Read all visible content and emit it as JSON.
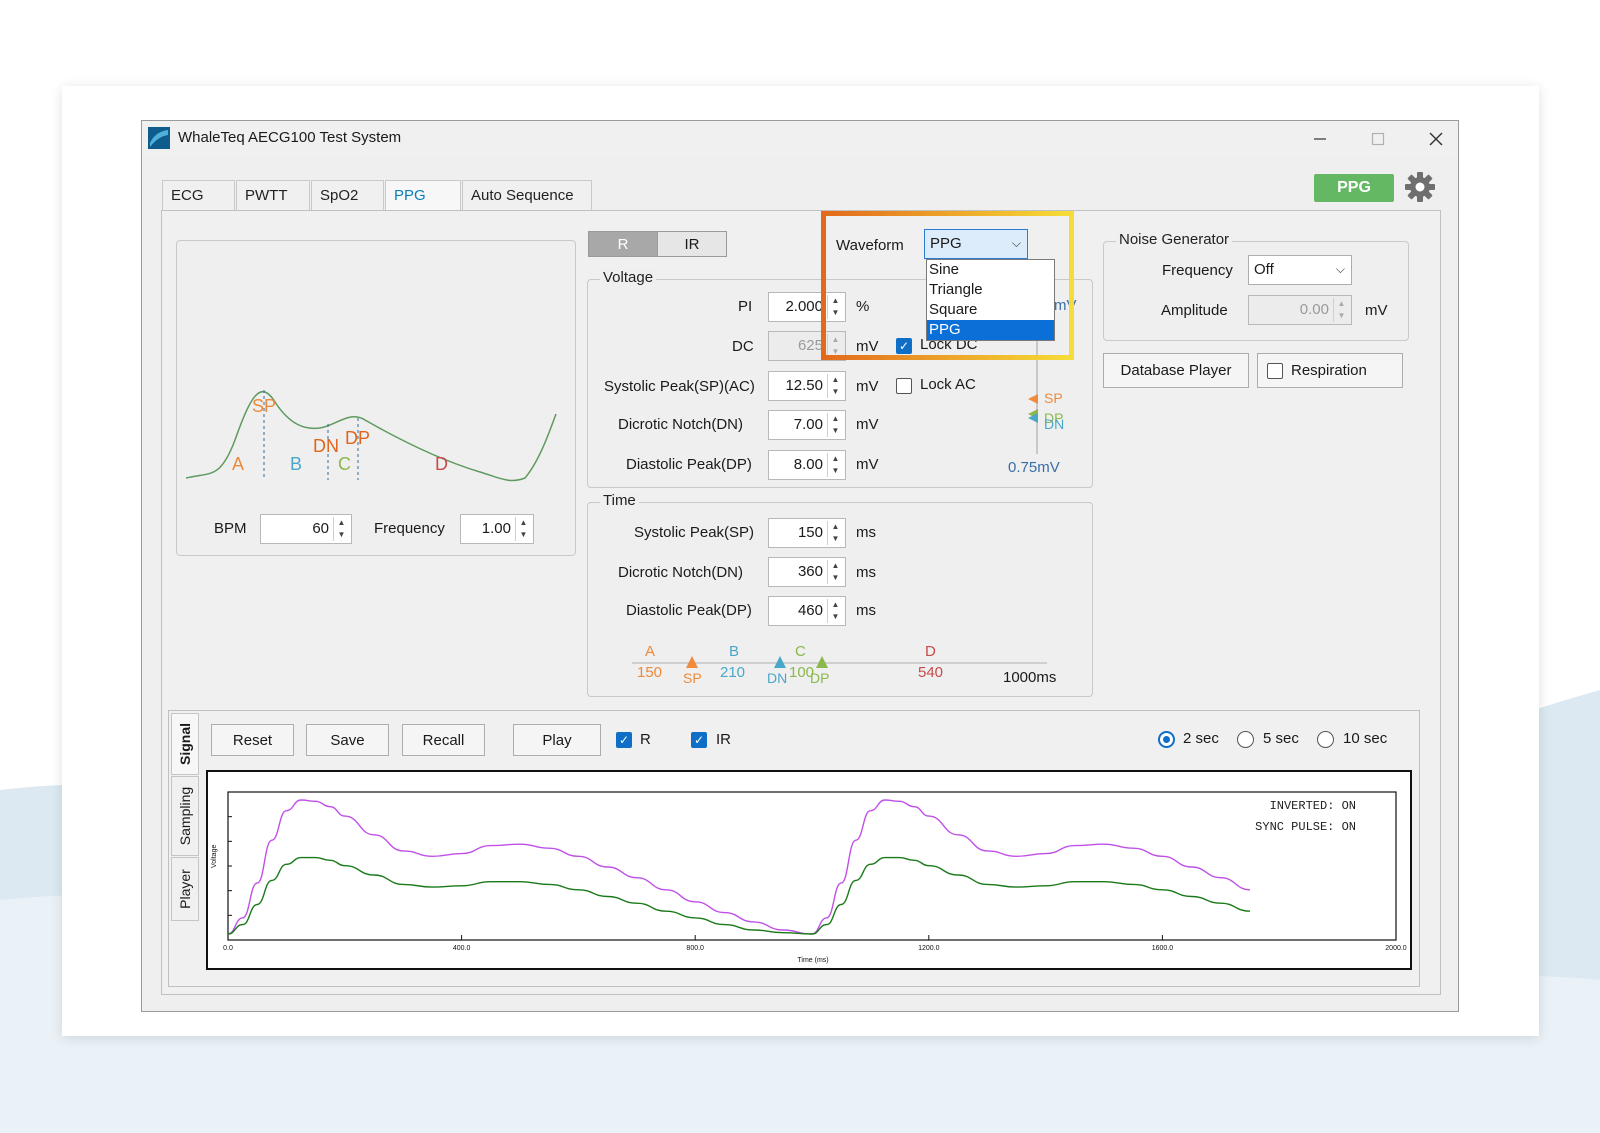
{
  "window": {
    "title": "WhaleTeq AECG100 Test System"
  },
  "tabs": [
    {
      "label": "ECG"
    },
    {
      "label": "PWTT"
    },
    {
      "label": "SpO2"
    },
    {
      "label": "PPG"
    },
    {
      "label": "Auto Sequence"
    }
  ],
  "mode_badge": "PPG",
  "preview": {
    "markers": [
      "SP",
      "DN",
      "DP"
    ],
    "segments": [
      "A",
      "B",
      "C",
      "D"
    ],
    "bpm_label": "BPM",
    "bpm_value": "60",
    "frequency_label": "Frequency",
    "frequency_value": "1.00"
  },
  "channel_toggle": {
    "r": "R",
    "ir": "IR"
  },
  "voltage": {
    "title": "Voltage",
    "pi_label": "PI",
    "pi_value": "2.000",
    "pi_unit": "%",
    "dc_label": "DC",
    "dc_value": "625",
    "dc_unit": "mV",
    "lock_dc_label": "Lock DC",
    "sp_label": "Systolic Peak(SP)(AC)",
    "sp_value": "12.50",
    "sp_unit": "mV",
    "lock_ac_label": "Lock AC",
    "dn_label": "Dicrotic Notch(DN)",
    "dn_value": "7.00",
    "dn_unit": "mV",
    "dp_label": "Diastolic Peak(DP)",
    "dp_value": "8.00",
    "dp_unit": "mV",
    "scale_top": "mV",
    "scale_value": "0.75mV",
    "scale_sp": "SP",
    "scale_dp": "DP",
    "scale_dn": "DN"
  },
  "waveform": {
    "label": "Waveform",
    "selected": "PPG",
    "options": [
      "Sine",
      "Triangle",
      "Square",
      "PPG"
    ]
  },
  "time": {
    "title": "Time",
    "sp_label": "Systolic Peak(SP)",
    "sp_value": "150",
    "sp_unit": "ms",
    "dn_label": "Dicrotic Notch(DN)",
    "dn_value": "360",
    "dn_unit": "ms",
    "dp_label": "Diastolic Peak(DP)",
    "dp_value": "460",
    "dp_unit": "ms",
    "timeline": {
      "a": "A",
      "a_val": "150",
      "b": "B",
      "b_val": "210",
      "c": "C",
      "c_val": "100",
      "d": "D",
      "d_val": "540",
      "sp": "SP",
      "dn": "DN",
      "dp": "DP",
      "end": "1000ms"
    }
  },
  "noise": {
    "title": "Noise Generator",
    "frequency_label": "Frequency",
    "frequency_value": "Off",
    "amplitude_label": "Amplitude",
    "amplitude_value": "0.00",
    "amplitude_unit": "mV"
  },
  "database_player_label": "Database Player",
  "respiration_label": "Respiration",
  "bottom": {
    "vtabs": [
      "Signal",
      "Sampling",
      "Player"
    ],
    "buttons": {
      "reset": "Reset",
      "save": "Save",
      "recall": "Recall",
      "play": "Play"
    },
    "r_label": "R",
    "ir_label": "IR",
    "durations": [
      "2 sec",
      "5 sec",
      "10 sec"
    ],
    "selected_duration": "2 sec"
  },
  "plot": {
    "status_inverted": "INVERTED: ON",
    "status_sync": "SYNC PULSE: ON",
    "ylabel": "Voltage",
    "xlabel": "Time (ms)",
    "x_ticks": [
      "0.0",
      "400.0",
      "800.0",
      "1200.0",
      "1600.0",
      "2000.0"
    ],
    "colors": {
      "r": "#c050e8",
      "ir": "#1a7a1a"
    }
  },
  "chart_data": {
    "type": "line",
    "xlabel": "Time (ms)",
    "ylabel": "Voltage",
    "xlim": [
      0,
      2000
    ],
    "x": [
      0,
      25,
      50,
      75,
      100,
      125,
      150,
      175,
      200,
      250,
      300,
      350,
      400,
      450,
      500,
      550,
      600,
      650,
      700,
      750,
      800,
      850,
      900,
      950,
      1000,
      1025,
      1050,
      1075,
      1100,
      1125,
      1150,
      1175,
      1200,
      1250,
      1300,
      1350,
      1400,
      1450,
      1500,
      1550,
      1600,
      1650,
      1700,
      1750
    ],
    "series": [
      {
        "name": "R",
        "values": [
          0.0,
          0.12,
          0.38,
          0.7,
          0.92,
          1.0,
          0.99,
          0.95,
          0.88,
          0.74,
          0.62,
          0.58,
          0.6,
          0.66,
          0.67,
          0.64,
          0.58,
          0.5,
          0.42,
          0.33,
          0.24,
          0.16,
          0.09,
          0.03,
          0.0,
          0.12,
          0.38,
          0.7,
          0.92,
          1.0,
          0.99,
          0.95,
          0.88,
          0.74,
          0.62,
          0.58,
          0.6,
          0.66,
          0.67,
          0.64,
          0.58,
          0.5,
          0.42,
          0.33
        ]
      },
      {
        "name": "IR",
        "values": [
          0.0,
          0.07,
          0.22,
          0.4,
          0.52,
          0.57,
          0.57,
          0.55,
          0.51,
          0.44,
          0.37,
          0.35,
          0.36,
          0.39,
          0.39,
          0.37,
          0.33,
          0.28,
          0.23,
          0.17,
          0.12,
          0.07,
          0.03,
          0.01,
          0.0,
          0.07,
          0.22,
          0.4,
          0.52,
          0.57,
          0.57,
          0.55,
          0.51,
          0.44,
          0.37,
          0.35,
          0.36,
          0.39,
          0.39,
          0.37,
          0.33,
          0.28,
          0.23,
          0.17
        ]
      }
    ]
  }
}
